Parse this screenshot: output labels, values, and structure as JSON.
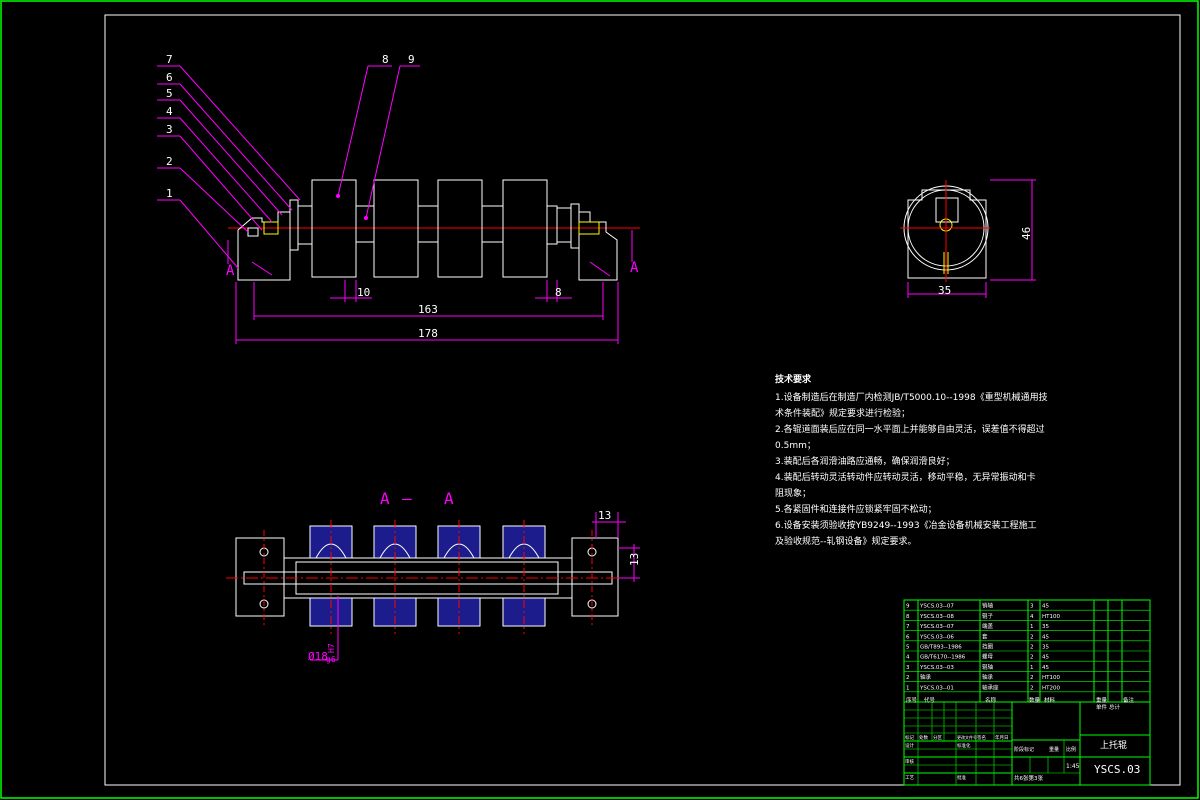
{
  "colors": {
    "background": "#000000",
    "outline": "#ffffff",
    "dimension": "#ff00ff",
    "centerline": "#ff0000",
    "hatch": "#3333ff",
    "detail": "#ffff00",
    "frame_outer": "#00ff00"
  },
  "front_view": {
    "section_marker_left": "A",
    "section_marker_right": "A",
    "part_labels": [
      "1",
      "2",
      "3",
      "4",
      "5",
      "6",
      "7",
      "8",
      "9"
    ],
    "dims": {
      "d10": "10",
      "d8": "8",
      "d163": "163",
      "d178": "178"
    }
  },
  "side_view": {
    "dims": {
      "height": "46",
      "width": "35"
    }
  },
  "section_view": {
    "title_left": "A",
    "title_sep": "—",
    "title_right": "A",
    "dims": {
      "d13a": "13",
      "d13b": "13",
      "shaft_dia": "Ø18",
      "fit_upper": "H7",
      "fit_lower": "g6"
    }
  },
  "tech_notes": {
    "title": "技术要求",
    "lines": [
      "1.设备制造后在制造厂内检测JB/T5000.10--1998《重型机械通用技",
      "术条件装配》规定要求进行检验；",
      "2.各辊道面装后应在同一水平面上并能够自由灵活，误差值不得超过",
      "0.5mm；",
      "3.装配后各润滑油路应通畅，确保润滑良好；",
      "4.装配后转动灵活转动件应转动灵活，移动平稳，无异常振动和卡",
      "阻现象；",
      "5.各紧固件和连接件应锁紧牢固不松动；",
      "6.设备安装须验收按YB9249--1993《冶金设备机械安装工程施工",
      "及验收规范--轧钢设备》规定要求。"
    ]
  },
  "parts_list": {
    "rows": [
      {
        "no": "9",
        "code": "YSCS.03--07",
        "name": "销轴",
        "qty": "3",
        "material": "45"
      },
      {
        "no": "8",
        "code": "YSCS.03--08",
        "name": "辊子",
        "qty": "4",
        "material": "HT100"
      },
      {
        "no": "7",
        "code": "YSCS.03--07",
        "name": "端盖",
        "qty": "1",
        "material": "35"
      },
      {
        "no": "6",
        "code": "YSCS.03--06",
        "name": "套",
        "qty": "2",
        "material": "45"
      },
      {
        "no": "5",
        "code": "GB/T893--1986",
        "name": "挡圈",
        "qty": "2",
        "material": "35"
      },
      {
        "no": "4",
        "code": "GB/T6170--1986",
        "name": "螺母",
        "qty": "2",
        "material": "45"
      },
      {
        "no": "3",
        "code": "YSCS.03--03",
        "name": "辊轴",
        "qty": "1",
        "material": "45"
      },
      {
        "no": "2",
        "code": "轴承",
        "name": "轴承",
        "qty": "2",
        "material": "HT100"
      },
      {
        "no": "1",
        "code": "YSCS.03--01",
        "name": "轴承座",
        "qty": "2",
        "material": "HT200"
      }
    ],
    "header": {
      "no": "序号",
      "code": "代号",
      "name": "名称",
      "qty": "数量",
      "material": "材料",
      "weight": "重量",
      "unit": "单件",
      "total": "总计",
      "note": "备注"
    }
  },
  "title_block": {
    "drawing_name": "上托辊",
    "drawing_code": "YSCS.03",
    "scale": "1:45",
    "labels": {
      "mark": "标记",
      "count": "处数",
      "zone": "分区",
      "change_doc": "更改文件号",
      "sign": "签名",
      "date": "年月日",
      "design": "设计",
      "standard": "标准化",
      "review": "审核",
      "process": "工艺",
      "approve": "批准",
      "stage_mark": "阶段标记",
      "weight": "重量",
      "ratio": "比例",
      "sheets": "共6张第3张"
    }
  }
}
